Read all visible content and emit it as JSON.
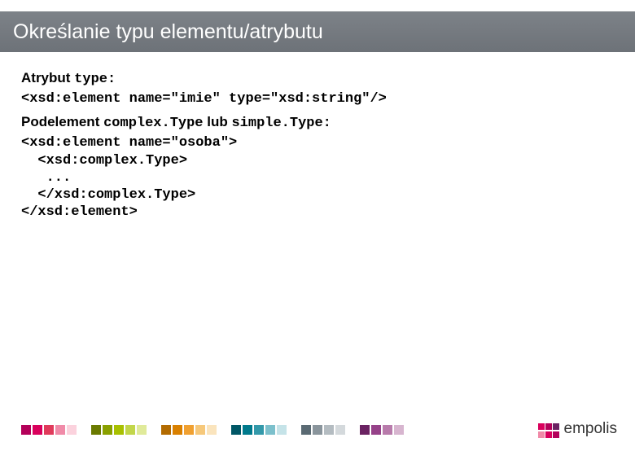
{
  "title": "Określanie typu elementu/atrybutu",
  "line1_prefix": "Atrybut ",
  "line1_mono": "type:",
  "code1": "<xsd:element name=\"imie\" type=\"xsd:string\"/>",
  "line2_prefix": "Podelement ",
  "line2_mono1": "complex.Type",
  "line2_mid": " lub ",
  "line2_mono2": "simple.Type:",
  "code2": "<xsd:element name=\"osoba\">\n  <xsd:complex.Type>\n   ...\n  </xsd:complex.Type>\n</xsd:element>",
  "logo_text": "empolis",
  "footer_colors": [
    "#b30059",
    "#d9005c",
    "#e03a5b",
    "#f08aa8",
    "#fbd2dd",
    null,
    "#6a7a00",
    "#8aa000",
    "#a8c000",
    "#c2d64a",
    "#e0ea9a",
    null,
    "#b36b00",
    "#d98000",
    "#f0a030",
    "#f6c87a",
    "#fae4bd",
    null,
    "#005766",
    "#007a8c",
    "#3399aa",
    "#7cc0cc",
    "#c5e3e8",
    null,
    "#5a6a73",
    "#8a959c",
    "#b4bcc1",
    "#d4d9dc",
    null,
    "#6a2262",
    "#964289",
    "#b87bab",
    "#d7b5cf"
  ],
  "logo_colors": {
    "top": [
      "#d9005c",
      "#b30059",
      "#6a2262"
    ],
    "bottom": [
      "#f08aa8",
      "#d9005c",
      "#b30059"
    ]
  }
}
